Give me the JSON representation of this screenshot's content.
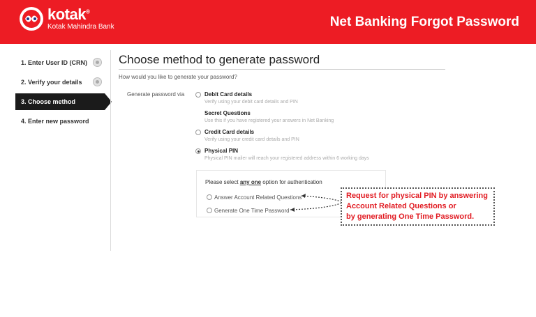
{
  "header": {
    "brand": "kotak",
    "brand_sub": "Kotak Mahindra Bank",
    "title": "Net Banking Forgot Password",
    "bg_color": "#ed1c24"
  },
  "sidebar": {
    "steps": [
      {
        "label": "1. Enter User ID (CRN)",
        "state": "done"
      },
      {
        "label": "2. Verify your details",
        "state": "done"
      },
      {
        "label": "3. Choose method",
        "state": "active"
      },
      {
        "label": "4. Enter new password",
        "state": "pending"
      }
    ]
  },
  "main": {
    "title": "Choose method to generate password",
    "question": "How would you like to generate your password?",
    "via_label": "Generate password via",
    "options": [
      {
        "label": "Debit Card details",
        "desc": "Verify using your debit card details and PIN",
        "selected": false
      },
      {
        "label": "Secret Questions",
        "desc": "Use this if you have registered your answers in Net Banking",
        "selected": false
      },
      {
        "label": "Credit Card details",
        "desc": "Verify using your credit card details and PIN",
        "selected": false
      },
      {
        "label": "Physical PIN",
        "desc": "Physical PIN mailer will reach your registered address within 6 working days",
        "selected": true
      }
    ],
    "auth": {
      "head_prefix": "Please select ",
      "head_emph": "any one",
      "head_suffix": " option for authentication",
      "options": [
        {
          "label": "Answer Account Related Questions"
        },
        {
          "label": "Generate One Time Password"
        }
      ]
    }
  },
  "callout": {
    "lines": [
      "Request for physical PIN by answering",
      "Account Related Questions or",
      "by generating One Time Password."
    ],
    "color": "#e11b22"
  }
}
